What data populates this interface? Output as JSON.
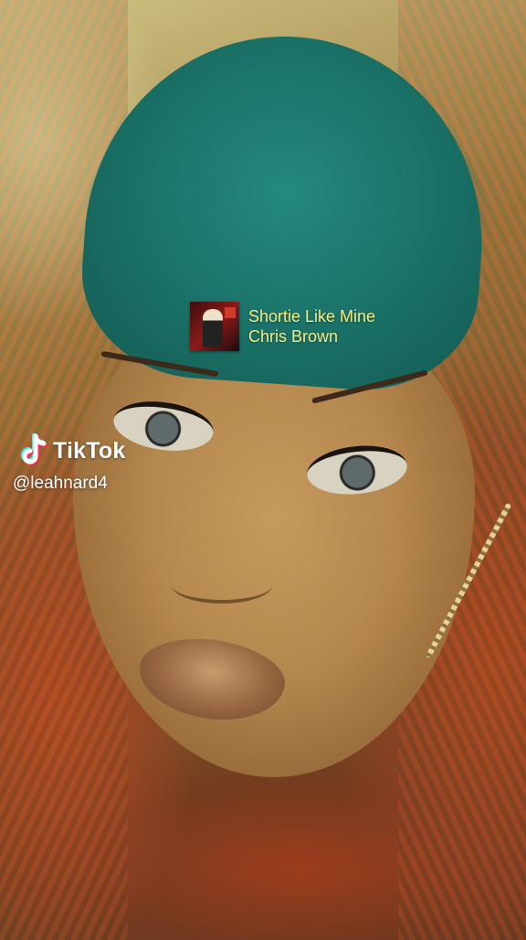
{
  "music_sticker": {
    "song_title": "Shortie Like Mine",
    "artist": "Chris Brown",
    "text_color": "#f4ec85"
  },
  "watermark": {
    "brand": "TikTok",
    "handle": "@leahnard4",
    "logo_icon": "tiktok-logo-icon",
    "colors": {
      "cyan": "#25f4ee",
      "red": "#fe2c55",
      "white": "#ffffff"
    }
  }
}
